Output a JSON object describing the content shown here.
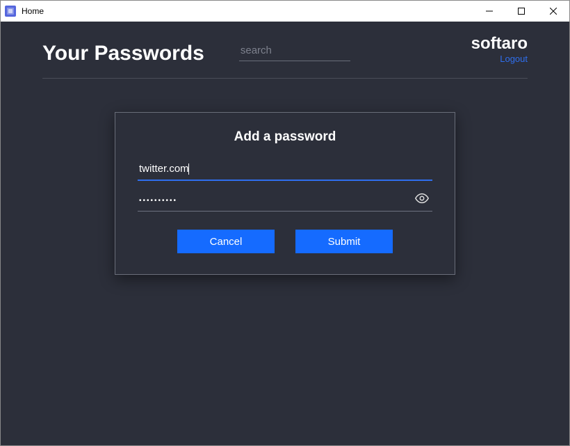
{
  "window": {
    "title": "Home"
  },
  "header": {
    "page_title": "Your Passwords",
    "search_placeholder": "search",
    "brand": "softaro",
    "logout_label": "Logout"
  },
  "modal": {
    "title": "Add a password",
    "site_value": "twitter.com",
    "password_mask": "••••••••••",
    "cancel_label": "Cancel",
    "submit_label": "Submit"
  },
  "colors": {
    "app_bg": "#2c2f3a",
    "accent": "#156bff",
    "link": "#2f6fee",
    "divider": "#4a4e59"
  }
}
